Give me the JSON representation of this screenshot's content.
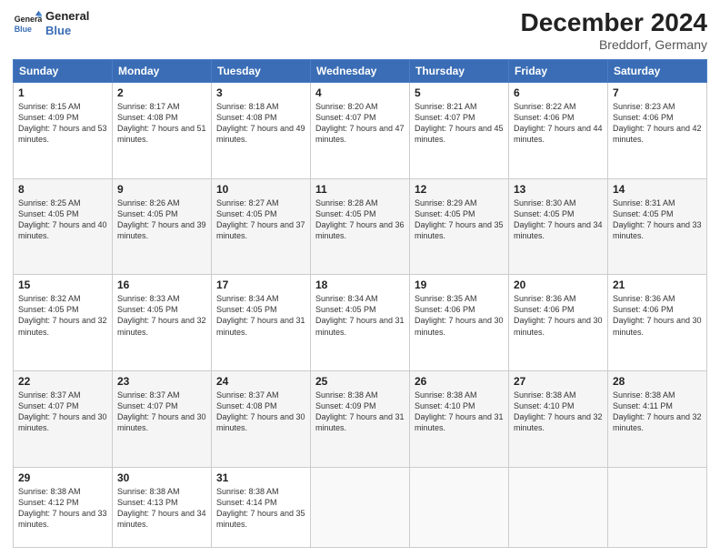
{
  "header": {
    "logo_line1": "General",
    "logo_line2": "Blue",
    "month_year": "December 2024",
    "location": "Breddorf, Germany"
  },
  "weekdays": [
    "Sunday",
    "Monday",
    "Tuesday",
    "Wednesday",
    "Thursday",
    "Friday",
    "Saturday"
  ],
  "weeks": [
    [
      {
        "day": "1",
        "sr": "8:15 AM",
        "ss": "4:09 PM",
        "dl": "7 hours and 53 minutes."
      },
      {
        "day": "2",
        "sr": "8:17 AM",
        "ss": "4:08 PM",
        "dl": "7 hours and 51 minutes."
      },
      {
        "day": "3",
        "sr": "8:18 AM",
        "ss": "4:08 PM",
        "dl": "7 hours and 49 minutes."
      },
      {
        "day": "4",
        "sr": "8:20 AM",
        "ss": "4:07 PM",
        "dl": "7 hours and 47 minutes."
      },
      {
        "day": "5",
        "sr": "8:21 AM",
        "ss": "4:07 PM",
        "dl": "7 hours and 45 minutes."
      },
      {
        "day": "6",
        "sr": "8:22 AM",
        "ss": "4:06 PM",
        "dl": "7 hours and 44 minutes."
      },
      {
        "day": "7",
        "sr": "8:23 AM",
        "ss": "4:06 PM",
        "dl": "7 hours and 42 minutes."
      }
    ],
    [
      {
        "day": "8",
        "sr": "8:25 AM",
        "ss": "4:05 PM",
        "dl": "7 hours and 40 minutes."
      },
      {
        "day": "9",
        "sr": "8:26 AM",
        "ss": "4:05 PM",
        "dl": "7 hours and 39 minutes."
      },
      {
        "day": "10",
        "sr": "8:27 AM",
        "ss": "4:05 PM",
        "dl": "7 hours and 37 minutes."
      },
      {
        "day": "11",
        "sr": "8:28 AM",
        "ss": "4:05 PM",
        "dl": "7 hours and 36 minutes."
      },
      {
        "day": "12",
        "sr": "8:29 AM",
        "ss": "4:05 PM",
        "dl": "7 hours and 35 minutes."
      },
      {
        "day": "13",
        "sr": "8:30 AM",
        "ss": "4:05 PM",
        "dl": "7 hours and 34 minutes."
      },
      {
        "day": "14",
        "sr": "8:31 AM",
        "ss": "4:05 PM",
        "dl": "7 hours and 33 minutes."
      }
    ],
    [
      {
        "day": "15",
        "sr": "8:32 AM",
        "ss": "4:05 PM",
        "dl": "7 hours and 32 minutes."
      },
      {
        "day": "16",
        "sr": "8:33 AM",
        "ss": "4:05 PM",
        "dl": "7 hours and 32 minutes."
      },
      {
        "day": "17",
        "sr": "8:34 AM",
        "ss": "4:05 PM",
        "dl": "7 hours and 31 minutes."
      },
      {
        "day": "18",
        "sr": "8:34 AM",
        "ss": "4:05 PM",
        "dl": "7 hours and 31 minutes."
      },
      {
        "day": "19",
        "sr": "8:35 AM",
        "ss": "4:06 PM",
        "dl": "7 hours and 30 minutes."
      },
      {
        "day": "20",
        "sr": "8:36 AM",
        "ss": "4:06 PM",
        "dl": "7 hours and 30 minutes."
      },
      {
        "day": "21",
        "sr": "8:36 AM",
        "ss": "4:06 PM",
        "dl": "7 hours and 30 minutes."
      }
    ],
    [
      {
        "day": "22",
        "sr": "8:37 AM",
        "ss": "4:07 PM",
        "dl": "7 hours and 30 minutes."
      },
      {
        "day": "23",
        "sr": "8:37 AM",
        "ss": "4:07 PM",
        "dl": "7 hours and 30 minutes."
      },
      {
        "day": "24",
        "sr": "8:37 AM",
        "ss": "4:08 PM",
        "dl": "7 hours and 30 minutes."
      },
      {
        "day": "25",
        "sr": "8:38 AM",
        "ss": "4:09 PM",
        "dl": "7 hours and 31 minutes."
      },
      {
        "day": "26",
        "sr": "8:38 AM",
        "ss": "4:10 PM",
        "dl": "7 hours and 31 minutes."
      },
      {
        "day": "27",
        "sr": "8:38 AM",
        "ss": "4:10 PM",
        "dl": "7 hours and 32 minutes."
      },
      {
        "day": "28",
        "sr": "8:38 AM",
        "ss": "4:11 PM",
        "dl": "7 hours and 32 minutes."
      }
    ],
    [
      {
        "day": "29",
        "sr": "8:38 AM",
        "ss": "4:12 PM",
        "dl": "7 hours and 33 minutes."
      },
      {
        "day": "30",
        "sr": "8:38 AM",
        "ss": "4:13 PM",
        "dl": "7 hours and 34 minutes."
      },
      {
        "day": "31",
        "sr": "8:38 AM",
        "ss": "4:14 PM",
        "dl": "7 hours and 35 minutes."
      },
      null,
      null,
      null,
      null
    ]
  ],
  "labels": {
    "sunrise": "Sunrise:",
    "sunset": "Sunset:",
    "daylight": "Daylight:"
  }
}
